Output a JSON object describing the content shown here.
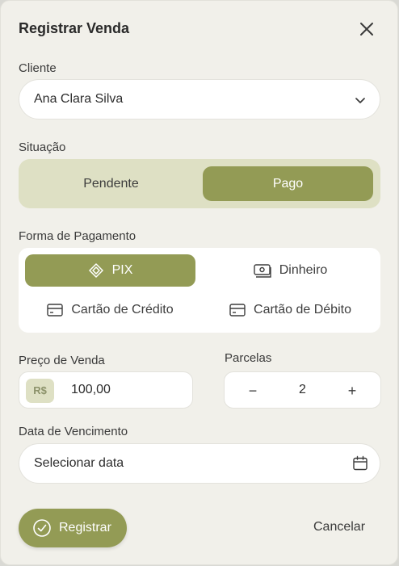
{
  "dialog": {
    "title": "Registrar Venda",
    "close_icon": "close-icon"
  },
  "cliente": {
    "label": "Cliente",
    "value": "Ana Clara Silva",
    "icon": "chevron-down-icon"
  },
  "situacao": {
    "label": "Situação",
    "options": [
      "Pendente",
      "Pago"
    ],
    "selected": "Pago"
  },
  "pagamento": {
    "label": "Forma de Pagamento",
    "options": [
      {
        "label": "PIX",
        "icon": "pix-icon"
      },
      {
        "label": "Dinheiro",
        "icon": "cash-icon"
      },
      {
        "label": "Cartão de Crédito",
        "icon": "credit-card-icon"
      },
      {
        "label": "Cartão de Débito",
        "icon": "debit-card-icon"
      }
    ],
    "selected": "PIX"
  },
  "preco": {
    "label": "Preço de Venda",
    "currency": "R$",
    "value": "100,00"
  },
  "parcelas": {
    "label": "Parcelas",
    "minus": "−",
    "value": "2",
    "plus": "+"
  },
  "vencimento": {
    "label": "Data de Vencimento",
    "placeholder": "Selecionar data",
    "icon": "calendar-icon"
  },
  "actions": {
    "submit_label": "Registrar",
    "submit_icon": "check-circle-icon",
    "cancel_label": "Cancelar"
  },
  "colors": {
    "accent": "#939b55",
    "accent_light": "#dee0c4",
    "background": "#f1f0ea",
    "field": "#ffffff"
  }
}
